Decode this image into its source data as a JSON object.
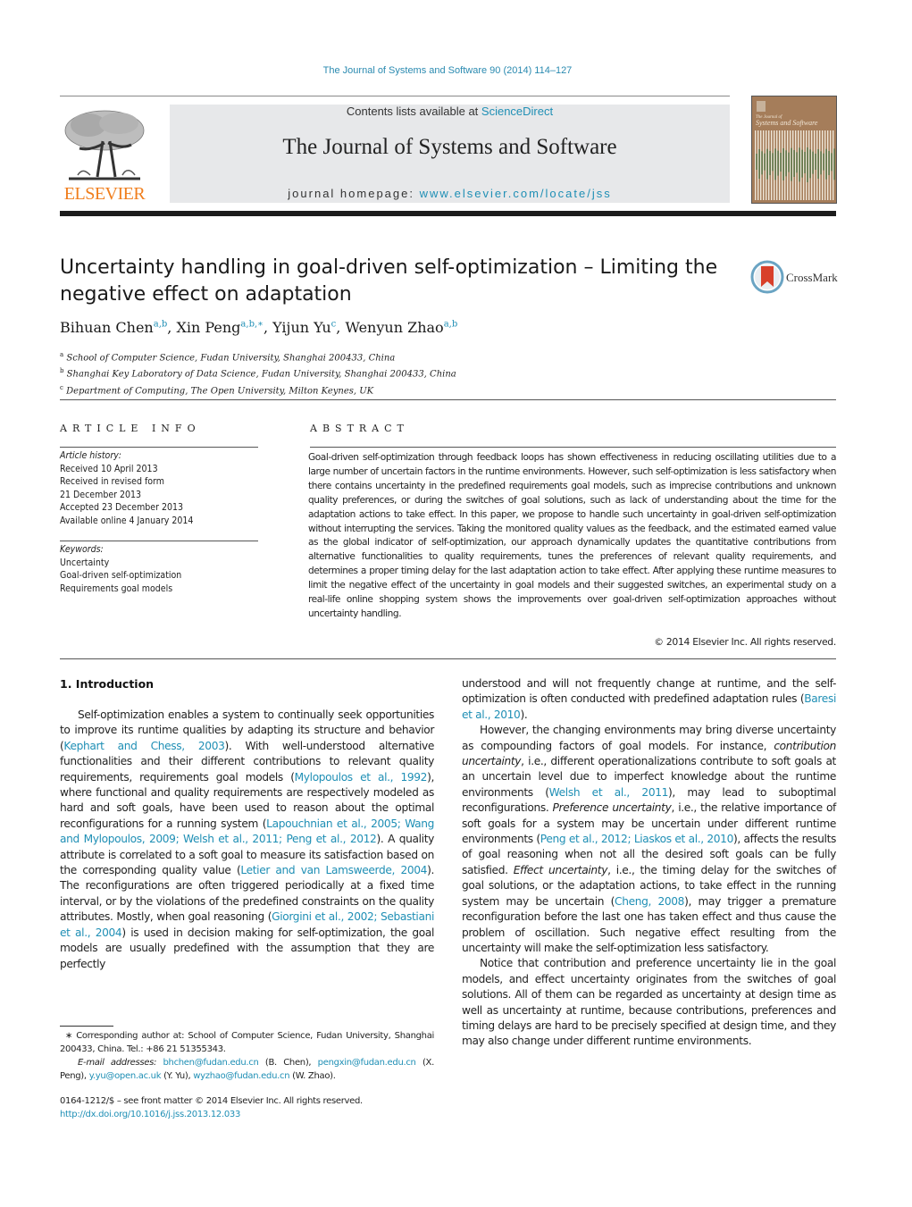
{
  "header": {
    "citation": "The Journal of Systems and Software 90 (2014) 114–127",
    "contents_prefix": "Contents lists available at ",
    "contents_link": "ScienceDirect",
    "journal_title": "The Journal of Systems and Software",
    "homepage_prefix": "journal homepage: ",
    "homepage_link": "www.elsevier.com/locate/jss",
    "publisher_logo_text": "ELSEVIER",
    "cover_title": "The Journal of Systems and Software",
    "crossmark_label": "CrossMark"
  },
  "colors": {
    "link": "#1f8fb5",
    "elsevier_orange": "#f07e1d",
    "band_gray": "#e7e8ea",
    "cover_brown": "#a57d5a"
  },
  "article": {
    "title": "Uncertainty handling in goal-driven self-optimization – Limiting the negative effect on adaptation",
    "authors": [
      {
        "name": "Bihuan Chen",
        "sup": "a,b"
      },
      {
        "name": "Xin Peng",
        "sup": "a,b,∗"
      },
      {
        "name": "Yijun Yu",
        "sup": "c"
      },
      {
        "name": "Wenyun Zhao",
        "sup": "a,b"
      }
    ],
    "affiliations": [
      {
        "key": "a",
        "text": "School of Computer Science, Fudan University, Shanghai 200433, China"
      },
      {
        "key": "b",
        "text": "Shanghai Key Laboratory of Data Science, Fudan University, Shanghai 200433, China"
      },
      {
        "key": "c",
        "text": "Department of Computing, The Open University, Milton Keynes, UK"
      }
    ]
  },
  "article_info": {
    "heading": "ARTICLE INFO",
    "history_label": "Article history:",
    "history": [
      "Received 10 April 2013",
      "Received in revised form",
      "21 December 2013",
      "Accepted 23 December 2013",
      "Available online 4 January 2014"
    ],
    "keywords_label": "Keywords:",
    "keywords": [
      "Uncertainty",
      "Goal-driven self-optimization",
      "Requirements goal models"
    ]
  },
  "abstract": {
    "heading": "ABSTRACT",
    "text": "Goal-driven self-optimization through feedback loops has shown effectiveness in reducing oscillating utilities due to a large number of uncertain factors in the runtime environments. However, such self-optimization is less satisfactory when there contains uncertainty in the predefined requirements goal models, such as imprecise contributions and unknown quality preferences, or during the switches of goal solutions, such as lack of understanding about the time for the adaptation actions to take effect. In this paper, we propose to handle such uncertainty in goal-driven self-optimization without interrupting the services. Taking the monitored quality values as the feedback, and the estimated earned value as the global indicator of self-optimization, our approach dynamically updates the quantitative contributions from alternative functionalities to quality requirements, tunes the preferences of relevant quality requirements, and determines a proper timing delay for the last adaptation action to take effect. After applying these runtime measures to limit the negative effect of the uncertainty in goal models and their suggested switches, an experimental study on a real-life online shopping system shows the improvements over goal-driven self-optimization approaches without uncertainty handling.",
    "copyright": "© 2014 Elsevier Inc. All rights reserved."
  },
  "body": {
    "section_heading": "1.  Introduction",
    "left": {
      "p1": [
        {
          "t": "Self-optimization enables a system to continually seek opportunities to improve its runtime qualities by adapting its structure and behavior ("
        },
        {
          "t": "Kephart and Chess, 2003",
          "link": true
        },
        {
          "t": "). With well-understood alternative functionalities and their different contributions to relevant quality requirements, requirements goal models ("
        },
        {
          "t": "Mylopoulos et al., 1992",
          "link": true
        },
        {
          "t": "), where functional and quality requirements are respectively modeled as hard and soft goals, have been used to reason about the optimal reconfigurations for a running system ("
        },
        {
          "t": "Lapouchnian et al., 2005; Wang and Mylopoulos, 2009; Welsh et al., 2011; Peng et al., 2012",
          "link": true
        },
        {
          "t": "). A quality attribute is correlated to a soft goal to measure its satisfaction based on the corresponding quality value ("
        },
        {
          "t": "Letier and van Lamsweerde, 2004",
          "link": true
        },
        {
          "t": "). The reconfigurations are often triggered periodically at a fixed time interval, or by the violations of the predefined constraints on the quality attributes. Mostly, when goal reasoning ("
        },
        {
          "t": "Giorgini et al., 2002; Sebastiani et al., 2004",
          "link": true
        },
        {
          "t": ") is used in decision making for self-optimization, the goal models are usually predefined with the assumption that they are perfectly"
        }
      ]
    },
    "right": {
      "p1": [
        {
          "t": "understood and will not frequently change at runtime, and the self-optimization is often conducted with predefined adaptation rules ("
        },
        {
          "t": "Baresi et al., 2010",
          "link": true
        },
        {
          "t": ")."
        }
      ],
      "p2": [
        {
          "t": "However, the changing environments may bring diverse uncertainty as compounding factors of goal models. For instance, "
        },
        {
          "t": "contribution uncertainty",
          "em": true
        },
        {
          "t": ", i.e., different operationalizations contribute to soft goals at an uncertain level due to imperfect knowledge about the runtime environments ("
        },
        {
          "t": "Welsh et al., 2011",
          "link": true
        },
        {
          "t": "), may lead to suboptimal reconfigurations. "
        },
        {
          "t": "Preference uncertainty",
          "em": true
        },
        {
          "t": ", i.e., the relative importance of soft goals for a system may be uncertain under different runtime environments ("
        },
        {
          "t": "Peng et al., 2012; Liaskos et al., 2010",
          "link": true
        },
        {
          "t": "), affects the results of goal reasoning when not all the desired soft goals can be fully satisfied. "
        },
        {
          "t": "Effect uncertainty",
          "em": true
        },
        {
          "t": ", i.e., the timing delay for the switches of goal solutions, or the adaptation actions, to take effect in the running system may be uncertain ("
        },
        {
          "t": "Cheng, 2008",
          "link": true
        },
        {
          "t": "), may trigger a premature reconfiguration before the last one has taken effect and thus cause the problem of oscillation. Such negative effect resulting from the uncertainty will make the self-optimization less satisfactory."
        }
      ],
      "p3": [
        {
          "t": "Notice that contribution and preference uncertainty lie in the goal models, and effect uncertainty originates from the switches of goal solutions. All of them can be regarded as uncertainty at design time as well as uncertainty at runtime, because contributions, preferences and timing delays are hard to be precisely specified at design time, and they may also change under different runtime environments."
        }
      ]
    }
  },
  "footnote": {
    "corresponding": "∗  Corresponding author at: School of Computer Science, Fudan University, Shanghai 200433, China. Tel.: +86 21 51355343.",
    "email_label": "E-mail addresses:",
    "emails": [
      {
        "addr": "bhchen@fudan.edu.cn",
        "who": "(B. Chen),"
      },
      {
        "addr": "pengxin@fudan.edu.cn",
        "who": "(X. Peng),"
      },
      {
        "addr": "y.yu@open.ac.uk",
        "who": "(Y. Yu),"
      },
      {
        "addr": "wyzhao@fudan.edu.cn",
        "who": "(W. Zhao)."
      }
    ]
  },
  "front_matter": {
    "issn_line": "0164-1212/$ – see front matter © 2014 Elsevier Inc. All rights reserved.",
    "doi": "http://dx.doi.org/10.1016/j.jss.2013.12.033"
  }
}
